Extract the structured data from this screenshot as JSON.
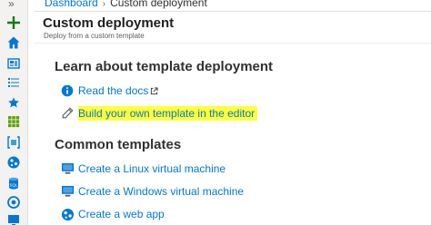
{
  "breadcrumb": {
    "items": [
      "Dashboard",
      "Custom deployment"
    ],
    "separator": "›"
  },
  "blade": {
    "title": "Custom deployment",
    "subtitle": "Deploy from a custom template"
  },
  "learn": {
    "heading": "Learn about template deployment",
    "read_docs": "Read the docs",
    "build_own": "Build your own template in the editor"
  },
  "common": {
    "heading": "Common templates",
    "items": [
      "Create a Linux virtual machine",
      "Create a Windows virtual machine",
      "Create a web app"
    ]
  },
  "rail": {
    "collapse_label": "»",
    "icons": [
      "create-resource-icon",
      "home-icon",
      "dashboard-icon",
      "all-services-icon",
      "favorites-star-icon",
      "all-resources-icon",
      "resource-groups-icon",
      "app-services-icon",
      "sql-databases-icon",
      "azure-cosmos-db-icon",
      "virtual-machines-icon"
    ]
  },
  "colors": {
    "link": "#0078d4",
    "highlight": "#ffff3a",
    "rail_background": "#f3f2f1"
  }
}
